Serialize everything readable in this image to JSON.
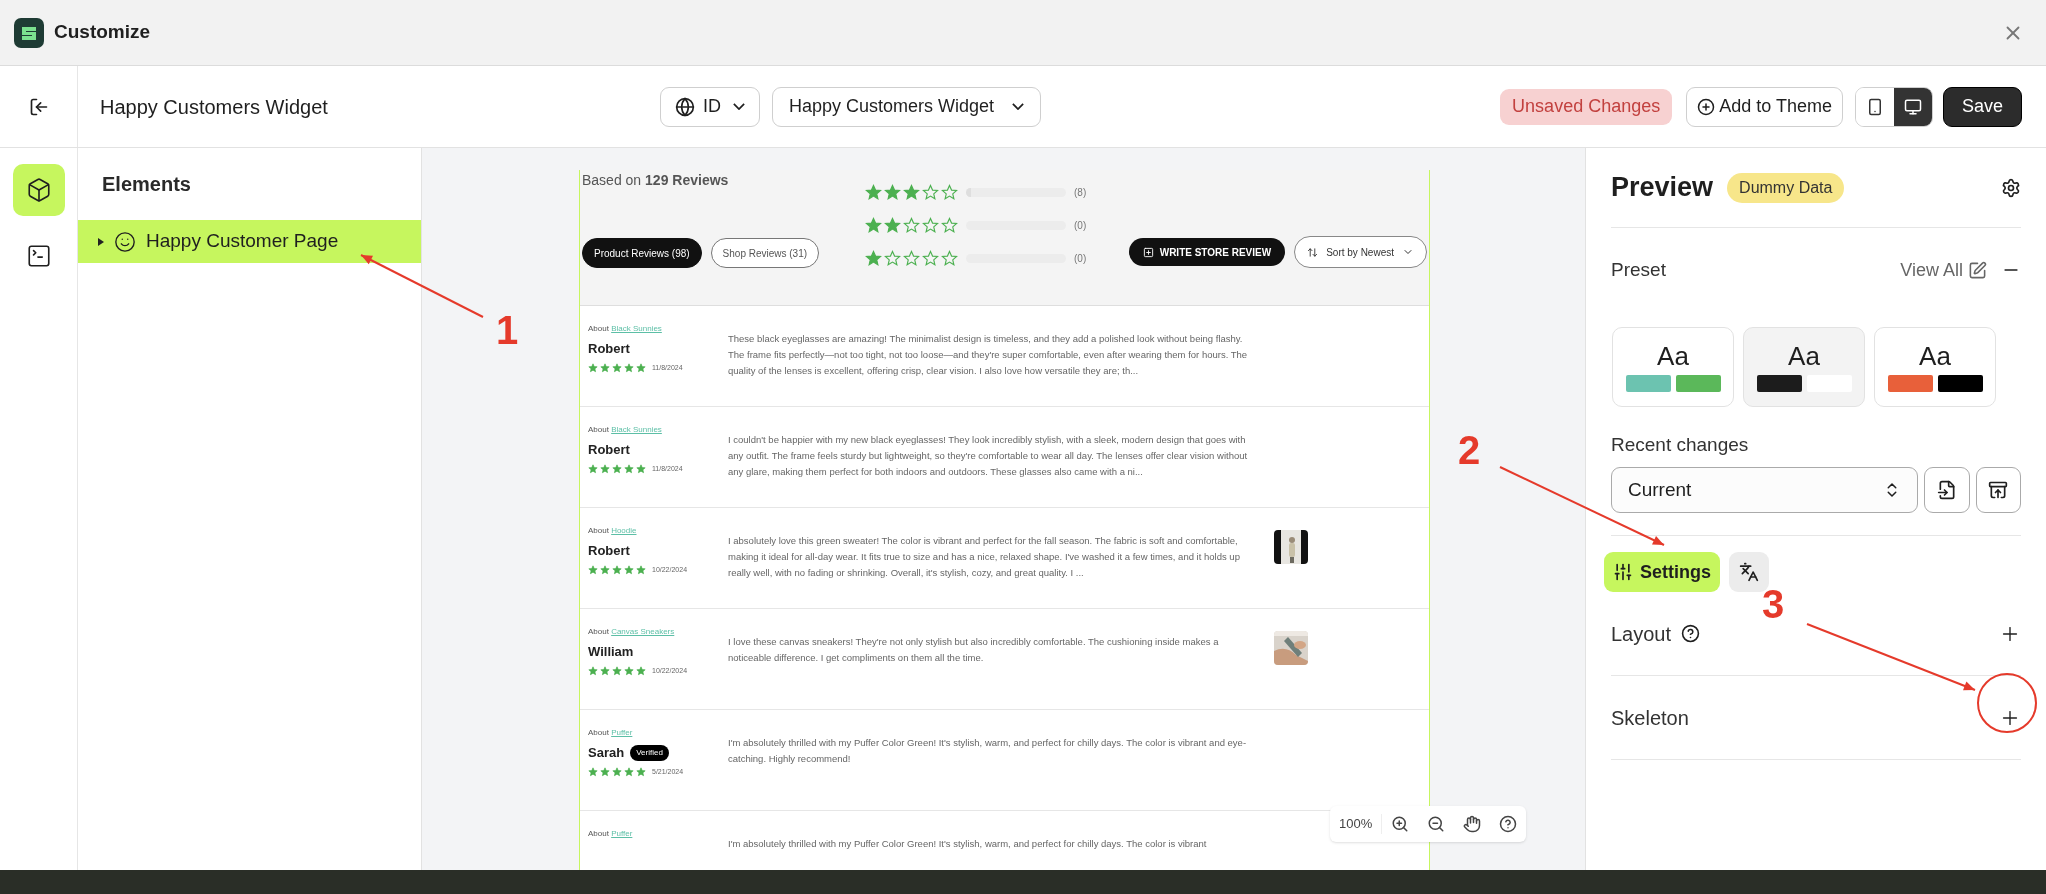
{
  "window": {
    "title": "Customize"
  },
  "toolbar": {
    "title": "Happy Customers Widget",
    "language": "ID",
    "widget_select": "Happy Customers Widget",
    "status_badge": "Unsaved Changes",
    "add_button": "Add to Theme",
    "save_button": "Save",
    "devices": [
      {
        "kind": "mobile",
        "selected": false
      },
      {
        "kind": "desktop",
        "selected": true
      }
    ]
  },
  "rail": [
    {
      "kind": "elements",
      "selected": true
    },
    {
      "kind": "code",
      "selected": false
    }
  ],
  "elements_panel": {
    "title": "Elements",
    "items": [
      {
        "label": "Happy Customer Page",
        "selected": true
      }
    ]
  },
  "preview": {
    "summary": "Based on **129 Reviews**",
    "ratings": [
      {
        "stars": 3,
        "level": 0.05,
        "count": "(8)"
      },
      {
        "stars": 2,
        "level": 0,
        "count": "(0)"
      },
      {
        "stars": 1,
        "level": 0,
        "count": "(0)"
      }
    ],
    "tabs": [
      {
        "label": "Product Reviews (98)",
        "selected": true
      },
      {
        "label": "Shop Reviews (31)",
        "selected": false
      }
    ],
    "write_button": "WRITE STORE REVIEW",
    "sort": "Sort by Newest",
    "reviews": [
      {
        "about": "About",
        "product": "Black Sunnies",
        "name": "Robert",
        "stars": 5,
        "date": "11/8/2024",
        "photo": false,
        "body": "These black eyeglasses are amazing! The minimalist design is timeless, and they add a polished look without being flashy. The frame fits perfectly—not too tight, not too loose—and they're super comfortable, even after wearing them for hours. The quality of the lenses is excellent, offering crisp, clear vision. I also love how versatile they are; th..."
      },
      {
        "about": "About",
        "product": "Black Sunnies",
        "name": "Robert",
        "stars": 5,
        "date": "11/8/2024",
        "photo": false,
        "body": "I couldn't be happier with my new black eyeglasses! They look incredibly stylish, with a sleek, modern design that goes with any outfit. The frame feels sturdy but lightweight, so they're comfortable to wear all day. The lenses offer clear vision without any glare, making them perfect for both indoors and outdoors. These glasses also came with a ni..."
      },
      {
        "about": "About",
        "product": "Hoodie",
        "name": "Robert",
        "stars": 5,
        "date": "10/22/2024",
        "photo": true,
        "body": "I absolutely love this green sweater! The color is vibrant and perfect for the fall season. The fabric is soft and comfortable, making it ideal for all-day wear. It fits true to size and has a nice, relaxed shape. I've washed it a few times, and it holds up really well, with no fading or shrinking. Overall, it's stylish, cozy, and great quality. I ..."
      },
      {
        "about": "About",
        "product": "Canvas Sneakers",
        "name": "William",
        "stars": 5,
        "date": "10/22/2024",
        "photo": true,
        "body": "I love these canvas sneakers! They're not only stylish but also incredibly comfortable. The cushioning inside makes a noticeable difference. I get compliments on them all the time."
      },
      {
        "about": "About",
        "product": "Puffer",
        "name": "Sarah",
        "badge": "Verified",
        "stars": 5,
        "date": "5/21/2024",
        "photo": false,
        "body": "I'm absolutely thrilled with my Puffer Color Green! It's stylish, warm, and perfect for chilly days. The color is vibrant and eye-catching. Highly recommend!"
      },
      {
        "about": "About",
        "product": "Puffer",
        "photo": false,
        "body": "I'm absolutely thrilled with my Puffer Color Green! It's stylish, warm, and perfect for chilly days. The color is vibrant"
      }
    ],
    "zoom": "100%"
  },
  "right_panel": {
    "title": "Preview",
    "badge": "Dummy Data",
    "preset": {
      "title": "Preset",
      "view_all": "View All",
      "cards": [
        {
          "sample": "Aa",
          "selected": false,
          "swatches": [
            {
              "color": "#6cc3b0"
            },
            {
              "color": "#5bb85a"
            }
          ]
        },
        {
          "sample": "Aa",
          "selected": true,
          "swatches": [
            {
              "color": "#1c1c1c"
            },
            {
              "color": "#ffffff"
            }
          ]
        },
        {
          "sample": "Aa",
          "selected": false,
          "swatches": [
            {
              "color": "#e8603a"
            },
            {
              "color": "#000000"
            }
          ]
        }
      ]
    },
    "recent_changes": {
      "label": "Recent changes",
      "value": "Current"
    },
    "tabs": [
      {
        "kind": "settings",
        "label": "Settings",
        "selected": true
      },
      {
        "kind": "translate",
        "selected": false
      }
    ],
    "sections": [
      {
        "title": "Layout",
        "help": true
      },
      {
        "title": "Skeleton",
        "help": false
      }
    ]
  },
  "annotations": [
    {
      "label": "1"
    },
    {
      "label": "2"
    },
    {
      "label": "3"
    }
  ]
}
